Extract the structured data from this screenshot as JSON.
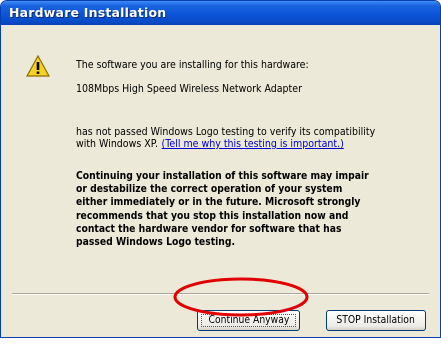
{
  "window": {
    "title": "Hardware Installation"
  },
  "icons": {
    "warning": "warning-triangle-icon"
  },
  "message": {
    "intro": "The software you are installing for this hardware:",
    "device_name": "108Mbps High Speed Wireless Network Adapter",
    "logo_line_1": "has not passed Windows Logo testing to verify its compatibility",
    "logo_line_2": "with Windows XP.",
    "logo_link": "(Tell me why this testing is important.)",
    "warning_lines": [
      "Continuing your installation of this software may impair",
      "or destabilize the correct operation of your system",
      "either immediately or in the future. Microsoft strongly",
      "recommends that you stop this installation now and",
      "contact the hardware vendor for software that has",
      "passed Windows Logo testing."
    ]
  },
  "buttons": {
    "continue_label": "Continue Anyway",
    "stop_label": "STOP Installation"
  },
  "annotation": {
    "highlight_color": "#e00000",
    "highlight_target": "continue-anyway-button"
  },
  "colors": {
    "titlebar": "#0c55d8",
    "dialog_bg": "#ece9d8",
    "link": "#0000cc"
  }
}
